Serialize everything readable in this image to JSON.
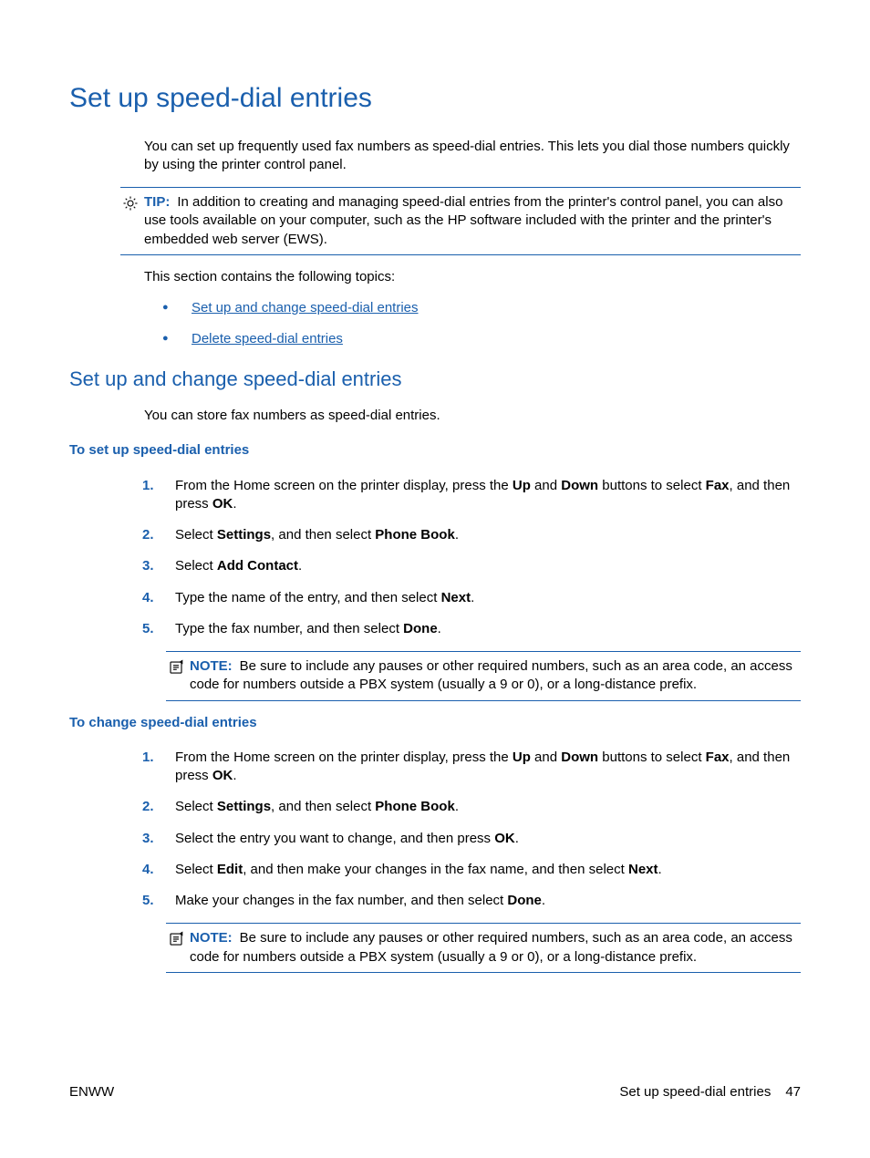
{
  "title": "Set up speed-dial entries",
  "intro": "You can set up frequently used fax numbers as speed-dial entries. This lets you dial those numbers quickly by using the printer control panel.",
  "tip": {
    "label": "TIP:",
    "text": "In addition to creating and managing speed-dial entries from the printer's control panel, you can also use tools available on your computer, such as the HP software included with the printer and the printer's embedded web server (EWS)."
  },
  "topics_intro": "This section contains the following topics:",
  "topics": [
    "Set up and change speed-dial entries",
    "Delete speed-dial entries"
  ],
  "section1": {
    "heading": "Set up and change speed-dial entries",
    "body": "You can store fax numbers as speed-dial entries."
  },
  "proc1": {
    "title": "To set up speed-dial entries",
    "steps": {
      "s1": {
        "a": "From the Home screen on the printer display, press the ",
        "b1": "Up",
        "c": " and ",
        "b2": "Down",
        "d": " buttons to select ",
        "b3": "Fax",
        "e": ", and then press ",
        "b4": "OK",
        "f": "."
      },
      "s2": {
        "a": "Select ",
        "b1": "Settings",
        "c": ", and then select ",
        "b2": "Phone Book",
        "d": "."
      },
      "s3": {
        "a": "Select ",
        "b1": "Add Contact",
        "c": "."
      },
      "s4": {
        "a": "Type the name of the entry, and then select ",
        "b1": "Next",
        "c": "."
      },
      "s5": {
        "a": "Type the fax number, and then select ",
        "b1": "Done",
        "c": "."
      }
    },
    "note": {
      "label": "NOTE:",
      "text": "Be sure to include any pauses or other required numbers, such as an area code, an access code for numbers outside a PBX system (usually a 9 or 0), or a long-distance prefix."
    }
  },
  "proc2": {
    "title": "To change speed-dial entries",
    "steps": {
      "s1": {
        "a": "From the Home screen on the printer display, press the ",
        "b1": "Up",
        "c": " and ",
        "b2": "Down",
        "d": " buttons to select ",
        "b3": "Fax",
        "e": ", and then press ",
        "b4": "OK",
        "f": "."
      },
      "s2": {
        "a": "Select ",
        "b1": "Settings",
        "c": ", and then select ",
        "b2": "Phone Book",
        "d": "."
      },
      "s3": {
        "a": "Select the entry you want to change, and then press ",
        "b1": "OK",
        "c": "."
      },
      "s4": {
        "a": "Select ",
        "b1": "Edit",
        "c": ", and then make your changes in the fax name, and then select ",
        "b2": "Next",
        "d": "."
      },
      "s5": {
        "a": "Make your changes in the fax number, and then select ",
        "b1": "Done",
        "c": "."
      }
    },
    "note": {
      "label": "NOTE:",
      "text": "Be sure to include any pauses or other required numbers, such as an area code, an access code for numbers outside a PBX system (usually a 9 or 0), or a long-distance prefix."
    }
  },
  "footer": {
    "left": "ENWW",
    "right_text": "Set up speed-dial entries",
    "page": "47"
  }
}
